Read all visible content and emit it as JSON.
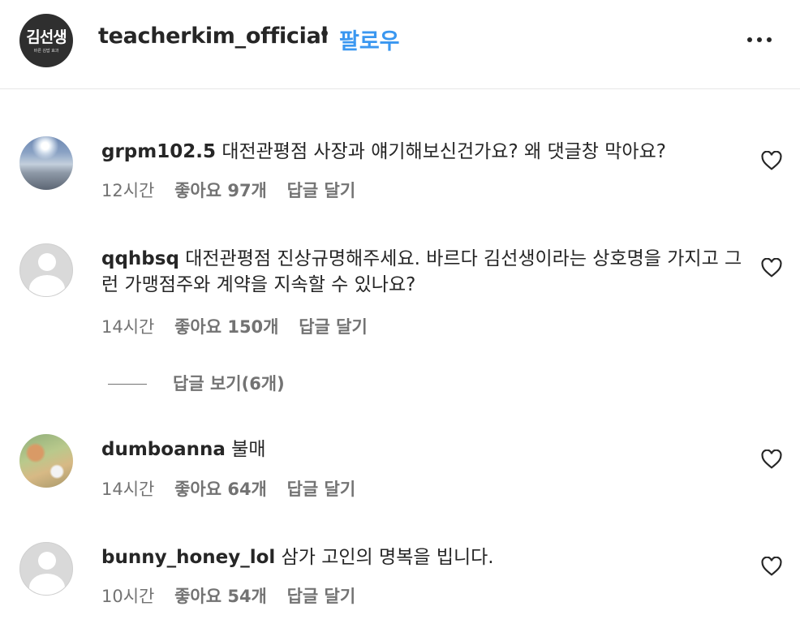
{
  "header": {
    "avatar_brand": "김선생",
    "avatar_sub": "바른 김밥 효과",
    "username": "teacherkim_official",
    "separator": "•",
    "follow_label": "팔로우"
  },
  "comments": [
    {
      "username": "grpm102.5",
      "text": "대전관평점 사장과 얘기해보신건가요? 왜 댓글창 막아요?",
      "time": "12시간",
      "likes": "좋아요 97개",
      "reply_label": "답글 달기",
      "avatar": "sky-photo"
    },
    {
      "username": "qqhbsq",
      "text": "대전관평점 진상규명해주세요. 바르다 김선생이라는 상호명을 가지고 그런 가맹점주와 계약을 지속할 수 있나요?",
      "time": "14시간",
      "likes": "좋아요 150개",
      "reply_label": "답글 달기",
      "avatar": "default-avatar"
    },
    {
      "username": "dumboanna",
      "text": "불매",
      "time": "14시간",
      "likes": "좋아요 64개",
      "reply_label": "답글 달기",
      "avatar": "bambi-photo"
    },
    {
      "username": "bunny_honey_lol",
      "text": "삼가 고인의 명복을 빕니다.",
      "time": "10시간",
      "likes": "좋아요 54개",
      "reply_label": "답글 달기",
      "avatar": "default-avatar"
    }
  ],
  "view_replies_label": "답글 보기(6개)",
  "icons": {
    "more": "more-options-icon",
    "like": "heart-outline-icon"
  },
  "colors": {
    "text": "#262626",
    "secondary": "#737373",
    "follow": "#3a97f0",
    "divider": "#e6e6e6"
  }
}
